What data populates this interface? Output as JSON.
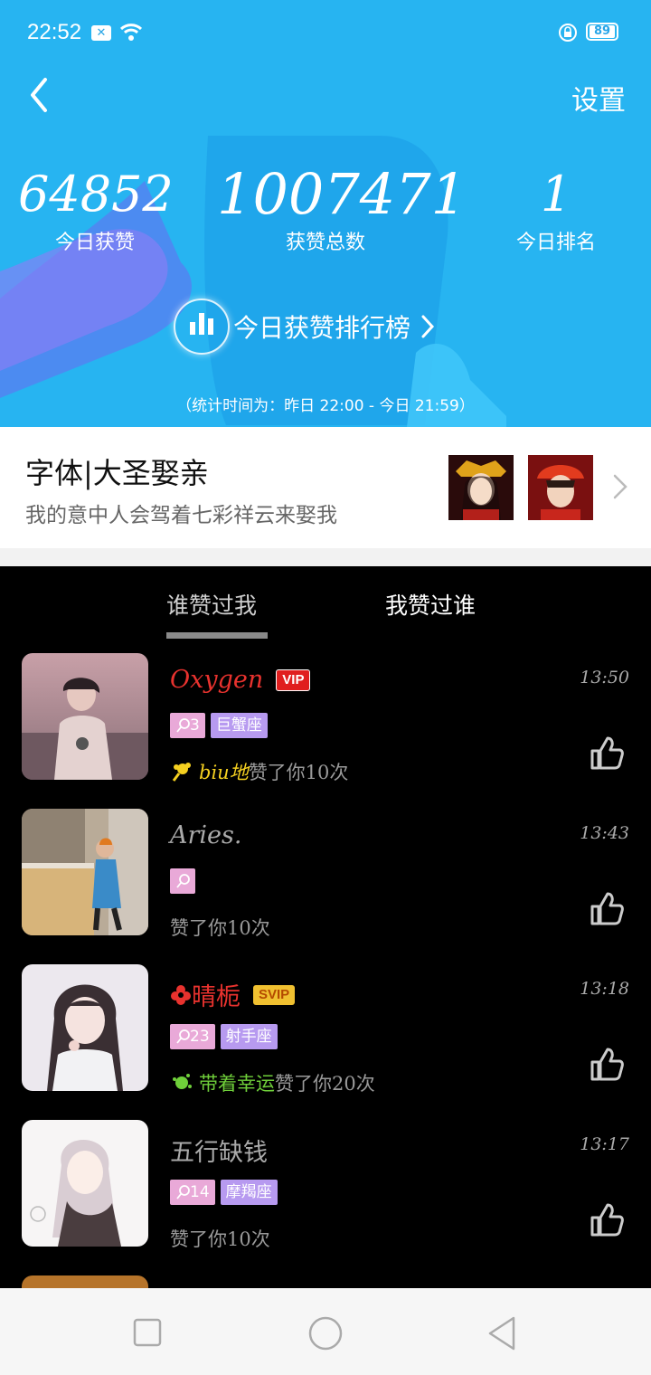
{
  "status_bar": {
    "time": "22:52",
    "battery": "89"
  },
  "header": {
    "settings_label": "设置"
  },
  "stats": [
    {
      "value": "64852",
      "label": "今日获赞"
    },
    {
      "value": "1007471",
      "label": "获赞总数"
    },
    {
      "value": "1",
      "label": "今日排名"
    }
  ],
  "ranking_button": {
    "label": "今日获赞排行榜"
  },
  "period_note": "（统计时间为：昨日 22:00 - 今日 21:59）",
  "profile": {
    "name": "字体|大圣娶亲",
    "signature": "我的意中人会驾着七彩祥云来娶我"
  },
  "tabs": [
    {
      "label": "谁赞过我",
      "active": true
    },
    {
      "label": "我赞过谁",
      "active": false
    }
  ],
  "likes": [
    {
      "name": "Oxygen",
      "name_color": "#e8322e",
      "badge": "VIP",
      "time": "13:50",
      "age": "3",
      "zodiac": "巨蟹座",
      "gift": "biu地",
      "gift_color": "#f5d020",
      "text": "赞了你10次"
    },
    {
      "name": "Aries.",
      "name_color": "#aaaaaa",
      "badge": "",
      "time": "13:43",
      "age": "",
      "zodiac": "",
      "gift": "",
      "gift_color": "",
      "text": "赞了你10次"
    },
    {
      "name": "晴栀",
      "name_color": "#e8322e",
      "badge": "SVIP",
      "time": "13:18",
      "age": "23",
      "zodiac": "射手座",
      "gift": "带着幸运",
      "gift_color": "#6fcf3a",
      "text": "赞了你20次"
    },
    {
      "name": "五行缺钱",
      "name_color": "#aaaaaa",
      "badge": "",
      "time": "13:17",
      "age": "14",
      "zodiac": "摩羯座",
      "gift": "",
      "gift_color": "",
      "text": "赞了你10次"
    }
  ],
  "colors": {
    "hero_bg": "#27b4f1",
    "tab_indicator": "#8a8a8a",
    "age_tag": "#e9a9d8",
    "zodiac_tag": "#b79af0"
  }
}
